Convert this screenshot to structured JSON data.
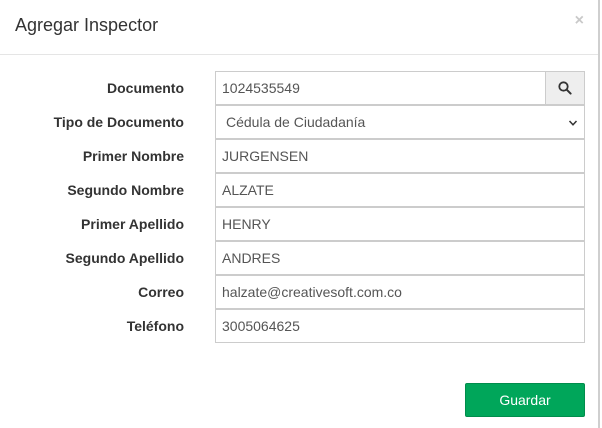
{
  "modal": {
    "title": "Agregar Inspector",
    "close_symbol": "×",
    "close_icon": "close-icon"
  },
  "form": {
    "fields": [
      {
        "label": "Documento",
        "value": "1024535549",
        "type": "text-with-search"
      },
      {
        "label": "Tipo de Documento",
        "value": "Cédula de Ciudadanía",
        "type": "select"
      },
      {
        "label": "Primer Nombre",
        "value": "JURGENSEN",
        "type": "text"
      },
      {
        "label": "Segundo Nombre",
        "value": "ALZATE",
        "type": "text"
      },
      {
        "label": "Primer Apellido",
        "value": "HENRY",
        "type": "text"
      },
      {
        "label": "Segundo Apellido",
        "value": "ANDRES",
        "type": "text"
      },
      {
        "label": "Correo",
        "value": "halzate@creativesoft.com.co",
        "type": "text"
      },
      {
        "label": "Teléfono",
        "value": "3005064625",
        "type": "text"
      }
    ],
    "search_icon": "search-icon",
    "select_icon": "chevron-down-icon"
  },
  "actions": {
    "save_label": "Guardar"
  },
  "colors": {
    "save_button": "#00a65a",
    "field_border": "#cccccc",
    "search_button_bg": "#eeeeee"
  }
}
